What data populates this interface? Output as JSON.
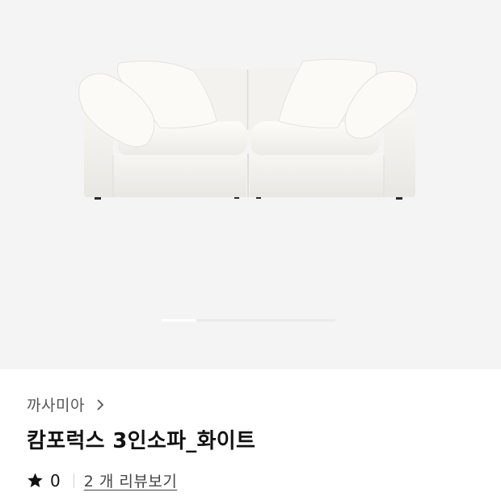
{
  "product": {
    "brand": "까사미아",
    "title": "캄포럭스 3인소파_화이트",
    "rating": "0",
    "review_link": "2 개 리뷰보기"
  },
  "gallery": {
    "image": "white-modular-sofa-photo",
    "slide_progress": 0.2
  },
  "icons": {
    "brand_chevron": "chevron-right-icon",
    "rating": "star-icon"
  },
  "colors": {
    "background_gallery": "#f4f4f4",
    "text_primary": "#111111",
    "text_secondary": "#555555"
  }
}
